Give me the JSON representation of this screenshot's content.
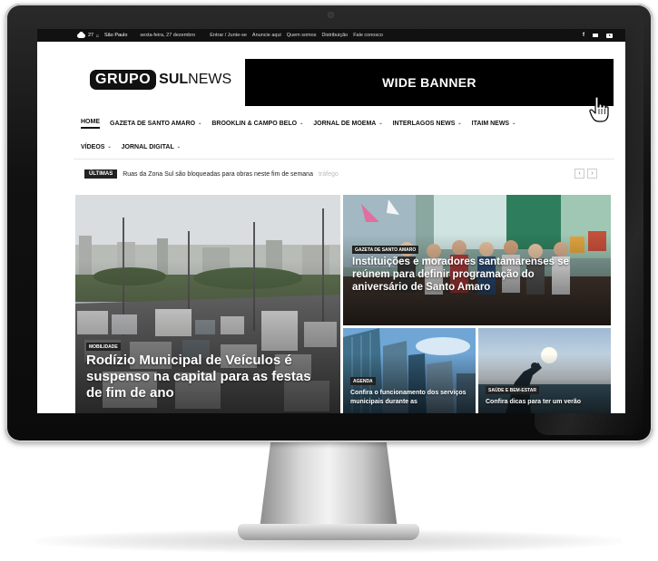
{
  "topbar": {
    "temperature": "27",
    "degree": "C",
    "city": "São Paulo",
    "date": "sexta-feira, 27 dezembro",
    "links": [
      "Entrar / Junte-se",
      "Anuncie aqui",
      "Quem somos",
      "Distribuição",
      "Fale conosco"
    ],
    "social_icons": [
      "facebook-icon",
      "mail-icon",
      "youtube-icon"
    ],
    "facebook_glyph": "f"
  },
  "header": {
    "logo_part1": "GRUPO",
    "logo_part2": "SUL",
    "logo_part3": "NEWS",
    "banner": "WIDE BANNER"
  },
  "nav": {
    "row1": [
      {
        "label": "HOME",
        "dropdown": false
      },
      {
        "label": "GAZETA DE SANTO AMARO",
        "dropdown": true
      },
      {
        "label": "BROOKLIN & CAMPO BELO",
        "dropdown": true
      },
      {
        "label": "JORNAL DE MOEMA",
        "dropdown": true
      },
      {
        "label": "INTERLAGOS NEWS",
        "dropdown": true
      },
      {
        "label": "ITAIM NEWS",
        "dropdown": true
      }
    ],
    "row2": [
      {
        "label": "VÍDEOS",
        "dropdown": true
      },
      {
        "label": "JORNAL DIGITAL",
        "dropdown": true
      }
    ],
    "chevron": "⌄"
  },
  "ticker": {
    "badge": "ÚLTIMAS",
    "text": "Ruas da Zona Sul são bloqueadas para obras neste fim de semana",
    "fade": "tráfego",
    "prev": "‹",
    "next": "›"
  },
  "cards": {
    "main": {
      "tag": "MOBILIDADE",
      "title": "Rodízio Municipal de Veículos é suspenso na capital para as festas de fim de ano"
    },
    "right": {
      "tag": "GAZETA DE SANTO AMARO",
      "title": "Instituições e moradores santamarenses se reúnem para definir programação do aniversário de Santo Amaro"
    },
    "agenda": {
      "tag": "AGENDA",
      "title": "Confira o funcionamento dos serviços municipais durante as"
    },
    "saude": {
      "tag": "SAÚDE E BEM-ESTAR",
      "title": "Confira dicas para ter um verão"
    }
  },
  "colors": {
    "topbar_bg": "#111111",
    "banner_bg": "#000000",
    "tag_bg": "#222222"
  }
}
